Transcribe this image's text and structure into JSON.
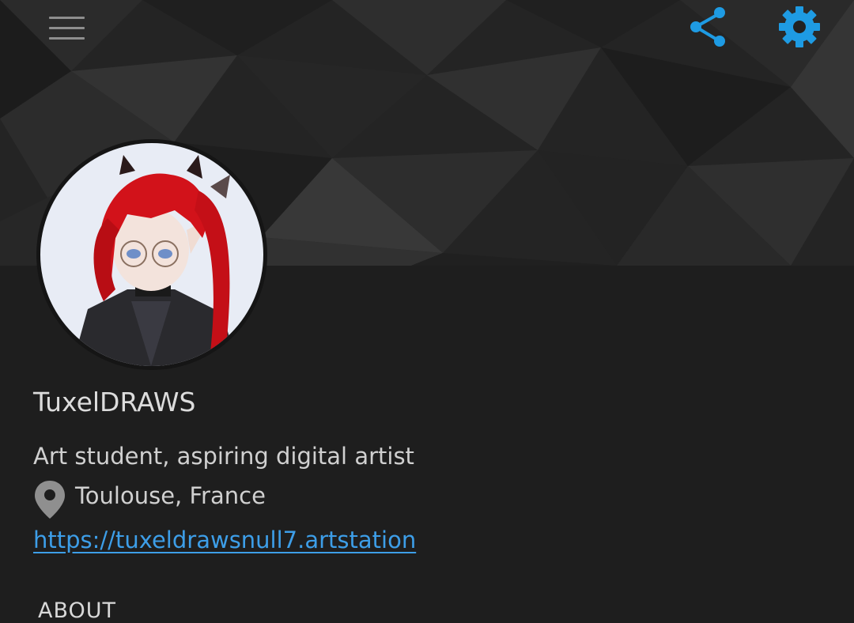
{
  "header": {
    "menu_icon": "hamburger-menu-icon",
    "share_icon": "share-icon",
    "settings_icon": "gear-icon",
    "accent_color": "#1e9be3"
  },
  "profile": {
    "name": "TuxelDRAWS",
    "bio": "Art student, aspiring digital artist",
    "location_icon": "map-pin-icon",
    "location": "Toulouse, France",
    "website": "https://tuxeldrawsnull7.artstation"
  },
  "sections": {
    "about_heading": "ABOUT"
  }
}
